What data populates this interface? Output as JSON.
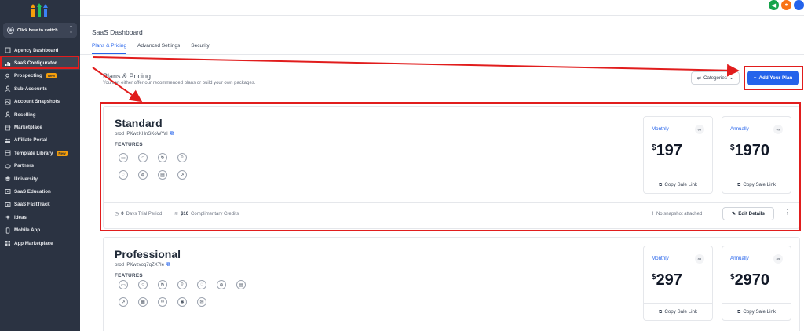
{
  "sidebar": {
    "switcher_label": "Click here to switch",
    "items": [
      {
        "label": "Agency Dashboard",
        "icon": "home-icon",
        "badge": ""
      },
      {
        "label": "SaaS Configurator",
        "icon": "chart-icon",
        "badge": ""
      },
      {
        "label": "Prospecting",
        "icon": "user-search-icon",
        "badge": "New"
      },
      {
        "label": "Sub-Accounts",
        "icon": "users-icon",
        "badge": ""
      },
      {
        "label": "Account Snapshots",
        "icon": "snapshot-icon",
        "badge": ""
      },
      {
        "label": "Reselling",
        "icon": "reselling-icon",
        "badge": ""
      },
      {
        "label": "Marketplace",
        "icon": "store-icon",
        "badge": ""
      },
      {
        "label": "Affiliate Portal",
        "icon": "affiliate-icon",
        "badge": ""
      },
      {
        "label": "Template Library",
        "icon": "template-icon",
        "badge": "New"
      },
      {
        "label": "Partners",
        "icon": "handshake-icon",
        "badge": ""
      },
      {
        "label": "University",
        "icon": "graduation-icon",
        "badge": ""
      },
      {
        "label": "SaaS Education",
        "icon": "education-icon",
        "badge": ""
      },
      {
        "label": "SaaS FastTrack",
        "icon": "fasttrack-icon",
        "badge": ""
      },
      {
        "label": "Ideas",
        "icon": "lightbulb-icon",
        "badge": ""
      },
      {
        "label": "Mobile App",
        "icon": "mobile-icon",
        "badge": ""
      },
      {
        "label": "App Marketplace",
        "icon": "apps-icon",
        "badge": ""
      }
    ]
  },
  "header": {
    "title": "SaaS Dashboard",
    "tabs": [
      {
        "label": "Plans & Pricing"
      },
      {
        "label": "Advanced Settings"
      },
      {
        "label": "Security"
      }
    ]
  },
  "section": {
    "title": "Plans & Pricing",
    "subtitle": "You can either offer our recommended plans or build your own packages.",
    "categories_label": "Categories",
    "add_plan_label": "Add Your Plan"
  },
  "plans": [
    {
      "name": "Standard",
      "product_id": "prod_PKwzKHnSKoWYal",
      "features_label": "FEATURES",
      "trial_value": "0",
      "trial_label": "Days Trial Period",
      "credits_value": "$10",
      "credits_label": "Complimentary Credits",
      "snapshot_label": "No snapshot attached",
      "edit_label": "Edit Details",
      "monthly": {
        "period": "Monthly",
        "currency": "$",
        "amount": "197",
        "copy_label": "Copy Sale Link"
      },
      "annually": {
        "period": "Annually",
        "currency": "$",
        "amount": "1970",
        "copy_label": "Copy Sale Link"
      }
    },
    {
      "name": "Professional",
      "product_id": "prod_PKwzvoq7qZX7Ie",
      "features_label": "FEATURES",
      "monthly": {
        "period": "Monthly",
        "currency": "$",
        "amount": "297",
        "copy_label": "Copy Sale Link"
      },
      "annually": {
        "period": "Annually",
        "currency": "$",
        "amount": "2970",
        "copy_label": "Copy Sale Link"
      }
    }
  ],
  "colors": {
    "sidebar_bg": "#2b3342",
    "accent": "#2563eb",
    "highlight": "#e11d1d"
  }
}
